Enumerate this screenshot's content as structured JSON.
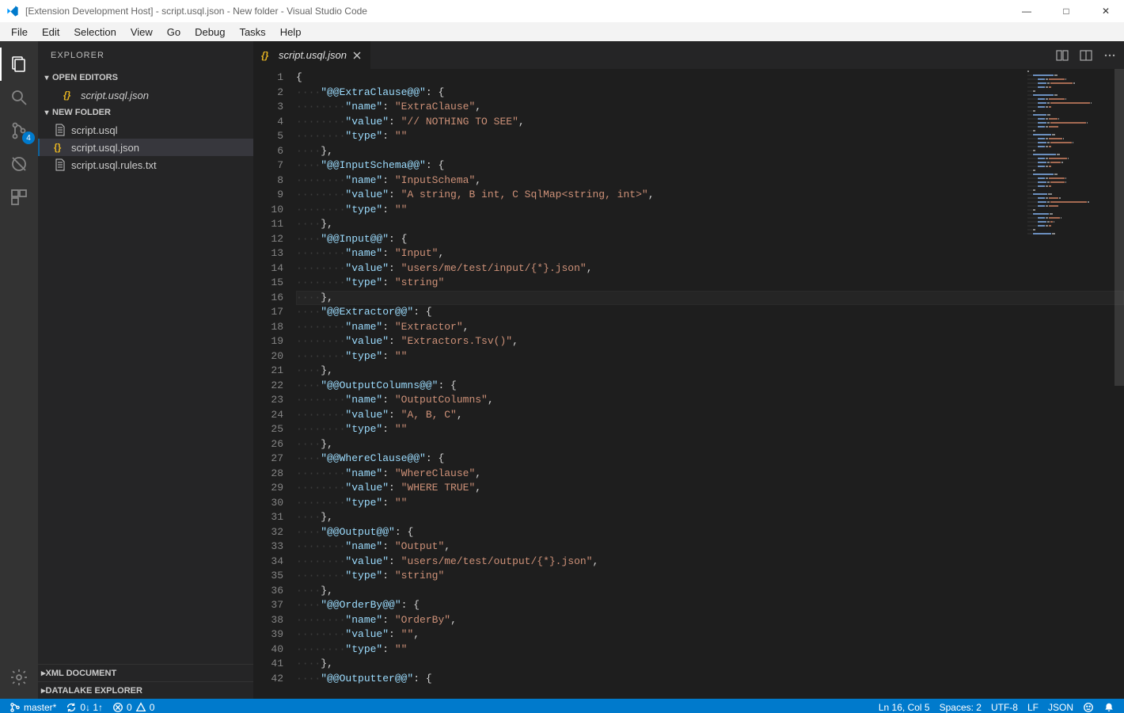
{
  "window": {
    "title": "[Extension Development Host] - script.usql.json - New folder - Visual Studio Code"
  },
  "menubar": [
    "File",
    "Edit",
    "Selection",
    "View",
    "Go",
    "Debug",
    "Tasks",
    "Help"
  ],
  "activitybar": {
    "scm_badge": "4"
  },
  "sidebar": {
    "title": "EXPLORER",
    "open_editors_label": "OPEN EDITORS",
    "folder_label": "NEW FOLDER",
    "open_editors": [
      {
        "name": "script.usql.json",
        "icon": "json"
      }
    ],
    "files": [
      {
        "name": "script.usql",
        "icon": "file"
      },
      {
        "name": "script.usql.json",
        "icon": "json",
        "selected": true
      },
      {
        "name": "script.usql.rules.txt",
        "icon": "file"
      }
    ],
    "bottom_sections": [
      "XML DOCUMENT",
      "DATALAKE EXPLORER"
    ]
  },
  "tab": {
    "label": "script.usql.json",
    "icon": "json"
  },
  "code": {
    "lines": [
      [
        [
          "pun",
          "{"
        ]
      ],
      [
        [
          "ws",
          "····"
        ],
        [
          "key",
          "\"@@ExtraClause@@\""
        ],
        [
          "pun",
          ": {"
        ]
      ],
      [
        [
          "ws",
          "········"
        ],
        [
          "key",
          "\"name\""
        ],
        [
          "pun",
          ": "
        ],
        [
          "str",
          "\"ExtraClause\""
        ],
        [
          "pun",
          ","
        ]
      ],
      [
        [
          "ws",
          "········"
        ],
        [
          "key",
          "\"value\""
        ],
        [
          "pun",
          ": "
        ],
        [
          "str",
          "\"// NOTHING TO SEE\""
        ],
        [
          "pun",
          ","
        ]
      ],
      [
        [
          "ws",
          "········"
        ],
        [
          "key",
          "\"type\""
        ],
        [
          "pun",
          ": "
        ],
        [
          "str",
          "\"\""
        ]
      ],
      [
        [
          "ws",
          "····"
        ],
        [
          "pun",
          "},"
        ]
      ],
      [
        [
          "ws",
          "····"
        ],
        [
          "key",
          "\"@@InputSchema@@\""
        ],
        [
          "pun",
          ": {"
        ]
      ],
      [
        [
          "ws",
          "········"
        ],
        [
          "key",
          "\"name\""
        ],
        [
          "pun",
          ": "
        ],
        [
          "str",
          "\"InputSchema\""
        ],
        [
          "pun",
          ","
        ]
      ],
      [
        [
          "ws",
          "········"
        ],
        [
          "key",
          "\"value\""
        ],
        [
          "pun",
          ": "
        ],
        [
          "str",
          "\"A string, B int, C SqlMap<string, int>\""
        ],
        [
          "pun",
          ","
        ]
      ],
      [
        [
          "ws",
          "········"
        ],
        [
          "key",
          "\"type\""
        ],
        [
          "pun",
          ": "
        ],
        [
          "str",
          "\"\""
        ]
      ],
      [
        [
          "ws",
          "····"
        ],
        [
          "pun",
          "},"
        ]
      ],
      [
        [
          "ws",
          "····"
        ],
        [
          "key",
          "\"@@Input@@\""
        ],
        [
          "pun",
          ": {"
        ]
      ],
      [
        [
          "ws",
          "········"
        ],
        [
          "key",
          "\"name\""
        ],
        [
          "pun",
          ": "
        ],
        [
          "str",
          "\"Input\""
        ],
        [
          "pun",
          ","
        ]
      ],
      [
        [
          "ws",
          "········"
        ],
        [
          "key",
          "\"value\""
        ],
        [
          "pun",
          ": "
        ],
        [
          "str",
          "\"users/me/test/input/{*}.json\""
        ],
        [
          "pun",
          ","
        ]
      ],
      [
        [
          "ws",
          "········"
        ],
        [
          "key",
          "\"type\""
        ],
        [
          "pun",
          ": "
        ],
        [
          "str",
          "\"string\""
        ]
      ],
      [
        [
          "ws",
          "····"
        ],
        [
          "pun",
          "},"
        ]
      ],
      [
        [
          "ws",
          "····"
        ],
        [
          "key",
          "\"@@Extractor@@\""
        ],
        [
          "pun",
          ": {"
        ]
      ],
      [
        [
          "ws",
          "········"
        ],
        [
          "key",
          "\"name\""
        ],
        [
          "pun",
          ": "
        ],
        [
          "str",
          "\"Extractor\""
        ],
        [
          "pun",
          ","
        ]
      ],
      [
        [
          "ws",
          "········"
        ],
        [
          "key",
          "\"value\""
        ],
        [
          "pun",
          ": "
        ],
        [
          "str",
          "\"Extractors.Tsv()\""
        ],
        [
          "pun",
          ","
        ]
      ],
      [
        [
          "ws",
          "········"
        ],
        [
          "key",
          "\"type\""
        ],
        [
          "pun",
          ": "
        ],
        [
          "str",
          "\"\""
        ]
      ],
      [
        [
          "ws",
          "····"
        ],
        [
          "pun",
          "},"
        ]
      ],
      [
        [
          "ws",
          "····"
        ],
        [
          "key",
          "\"@@OutputColumns@@\""
        ],
        [
          "pun",
          ": {"
        ]
      ],
      [
        [
          "ws",
          "········"
        ],
        [
          "key",
          "\"name\""
        ],
        [
          "pun",
          ": "
        ],
        [
          "str",
          "\"OutputColumns\""
        ],
        [
          "pun",
          ","
        ]
      ],
      [
        [
          "ws",
          "········"
        ],
        [
          "key",
          "\"value\""
        ],
        [
          "pun",
          ": "
        ],
        [
          "str",
          "\"A, B, C\""
        ],
        [
          "pun",
          ","
        ]
      ],
      [
        [
          "ws",
          "········"
        ],
        [
          "key",
          "\"type\""
        ],
        [
          "pun",
          ": "
        ],
        [
          "str",
          "\"\""
        ]
      ],
      [
        [
          "ws",
          "····"
        ],
        [
          "pun",
          "},"
        ]
      ],
      [
        [
          "ws",
          "····"
        ],
        [
          "key",
          "\"@@WhereClause@@\""
        ],
        [
          "pun",
          ": {"
        ]
      ],
      [
        [
          "ws",
          "········"
        ],
        [
          "key",
          "\"name\""
        ],
        [
          "pun",
          ": "
        ],
        [
          "str",
          "\"WhereClause\""
        ],
        [
          "pun",
          ","
        ]
      ],
      [
        [
          "ws",
          "········"
        ],
        [
          "key",
          "\"value\""
        ],
        [
          "pun",
          ": "
        ],
        [
          "str",
          "\"WHERE TRUE\""
        ],
        [
          "pun",
          ","
        ]
      ],
      [
        [
          "ws",
          "········"
        ],
        [
          "key",
          "\"type\""
        ],
        [
          "pun",
          ": "
        ],
        [
          "str",
          "\"\""
        ]
      ],
      [
        [
          "ws",
          "····"
        ],
        [
          "pun",
          "},"
        ]
      ],
      [
        [
          "ws",
          "····"
        ],
        [
          "key",
          "\"@@Output@@\""
        ],
        [
          "pun",
          ": {"
        ]
      ],
      [
        [
          "ws",
          "········"
        ],
        [
          "key",
          "\"name\""
        ],
        [
          "pun",
          ": "
        ],
        [
          "str",
          "\"Output\""
        ],
        [
          "pun",
          ","
        ]
      ],
      [
        [
          "ws",
          "········"
        ],
        [
          "key",
          "\"value\""
        ],
        [
          "pun",
          ": "
        ],
        [
          "str",
          "\"users/me/test/output/{*}.json\""
        ],
        [
          "pun",
          ","
        ]
      ],
      [
        [
          "ws",
          "········"
        ],
        [
          "key",
          "\"type\""
        ],
        [
          "pun",
          ": "
        ],
        [
          "str",
          "\"string\""
        ]
      ],
      [
        [
          "ws",
          "····"
        ],
        [
          "pun",
          "},"
        ]
      ],
      [
        [
          "ws",
          "····"
        ],
        [
          "key",
          "\"@@OrderBy@@\""
        ],
        [
          "pun",
          ": {"
        ]
      ],
      [
        [
          "ws",
          "········"
        ],
        [
          "key",
          "\"name\""
        ],
        [
          "pun",
          ": "
        ],
        [
          "str",
          "\"OrderBy\""
        ],
        [
          "pun",
          ","
        ]
      ],
      [
        [
          "ws",
          "········"
        ],
        [
          "key",
          "\"value\""
        ],
        [
          "pun",
          ": "
        ],
        [
          "str",
          "\"\""
        ],
        [
          "pun",
          ","
        ]
      ],
      [
        [
          "ws",
          "········"
        ],
        [
          "key",
          "\"type\""
        ],
        [
          "pun",
          ": "
        ],
        [
          "str",
          "\"\""
        ]
      ],
      [
        [
          "ws",
          "····"
        ],
        [
          "pun",
          "},"
        ]
      ],
      [
        [
          "ws",
          "····"
        ],
        [
          "key",
          "\"@@Outputter@@\""
        ],
        [
          "pun",
          ": {"
        ]
      ]
    ],
    "current_line": 16
  },
  "statusbar": {
    "branch": "master*",
    "sync": "0↓ 1↑",
    "errors": "0",
    "warnings": "0",
    "ln_col": "Ln 16, Col 5",
    "spaces": "Spaces: 2",
    "encoding": "UTF-8",
    "eol": "LF",
    "language": "JSON"
  }
}
